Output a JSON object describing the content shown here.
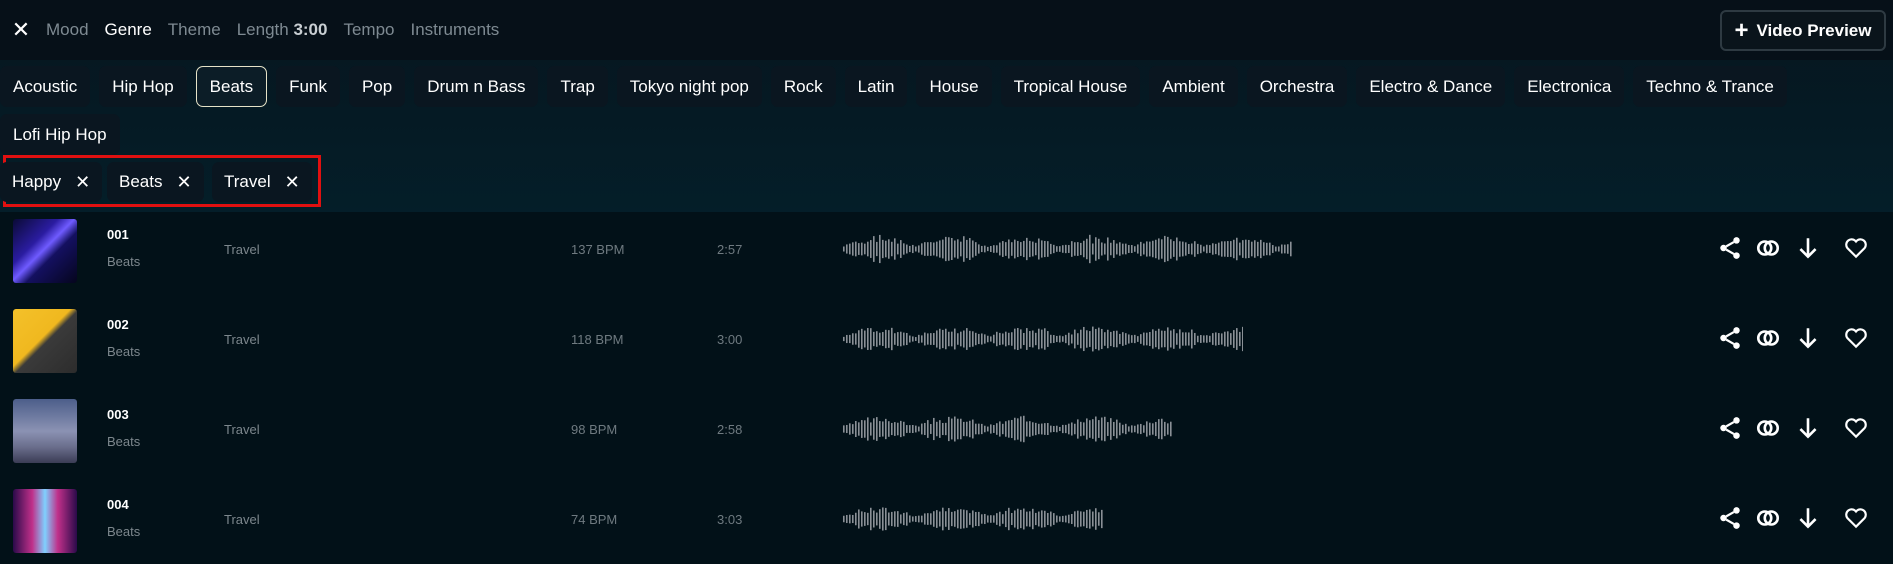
{
  "topbar": {
    "close_icon": "close-icon",
    "tabs": [
      {
        "label": "Mood",
        "active": false
      },
      {
        "label": "Genre",
        "active": true
      },
      {
        "label": "Theme",
        "active": false
      },
      {
        "label": "Length",
        "value": "3:00",
        "active": false
      },
      {
        "label": "Tempo",
        "active": false
      },
      {
        "label": "Instruments",
        "active": false
      }
    ],
    "video_button": {
      "icon": "plus-icon",
      "label": "Video Preview"
    }
  },
  "genres": [
    "Acoustic",
    "Hip Hop",
    "Beats",
    "Funk",
    "Pop",
    "Drum n Bass",
    "Trap",
    "Tokyo night pop",
    "Rock",
    "Latin",
    "House",
    "Tropical House",
    "Ambient",
    "Orchestra",
    "Electro & Dance",
    "Electronica",
    "Techno & Trance",
    "Lofi Hip Hop"
  ],
  "selected_genre": "Beats",
  "selected_filters": [
    "Happy",
    "Beats",
    "Travel"
  ],
  "tracks": [
    {
      "number": "001",
      "genre": "Beats",
      "theme": "Travel",
      "bpm": "137 BPM",
      "duration": "2:57"
    },
    {
      "number": "002",
      "genre": "Beats",
      "theme": "Travel",
      "bpm": "118 BPM",
      "duration": "3:00"
    },
    {
      "number": "003",
      "genre": "Beats",
      "theme": "Travel",
      "bpm": "98 BPM",
      "duration": "2:58"
    },
    {
      "number": "004",
      "genre": "Beats",
      "theme": "Travel",
      "bpm": "74 BPM",
      "duration": "3:03"
    }
  ],
  "track_actions": [
    "share-icon",
    "link-icon",
    "download-icon",
    "heart-icon"
  ],
  "colors": {
    "accent_border": "#e01010",
    "chip_bg": "#0a1620",
    "selected_chip_border": "#e6e3c8"
  }
}
